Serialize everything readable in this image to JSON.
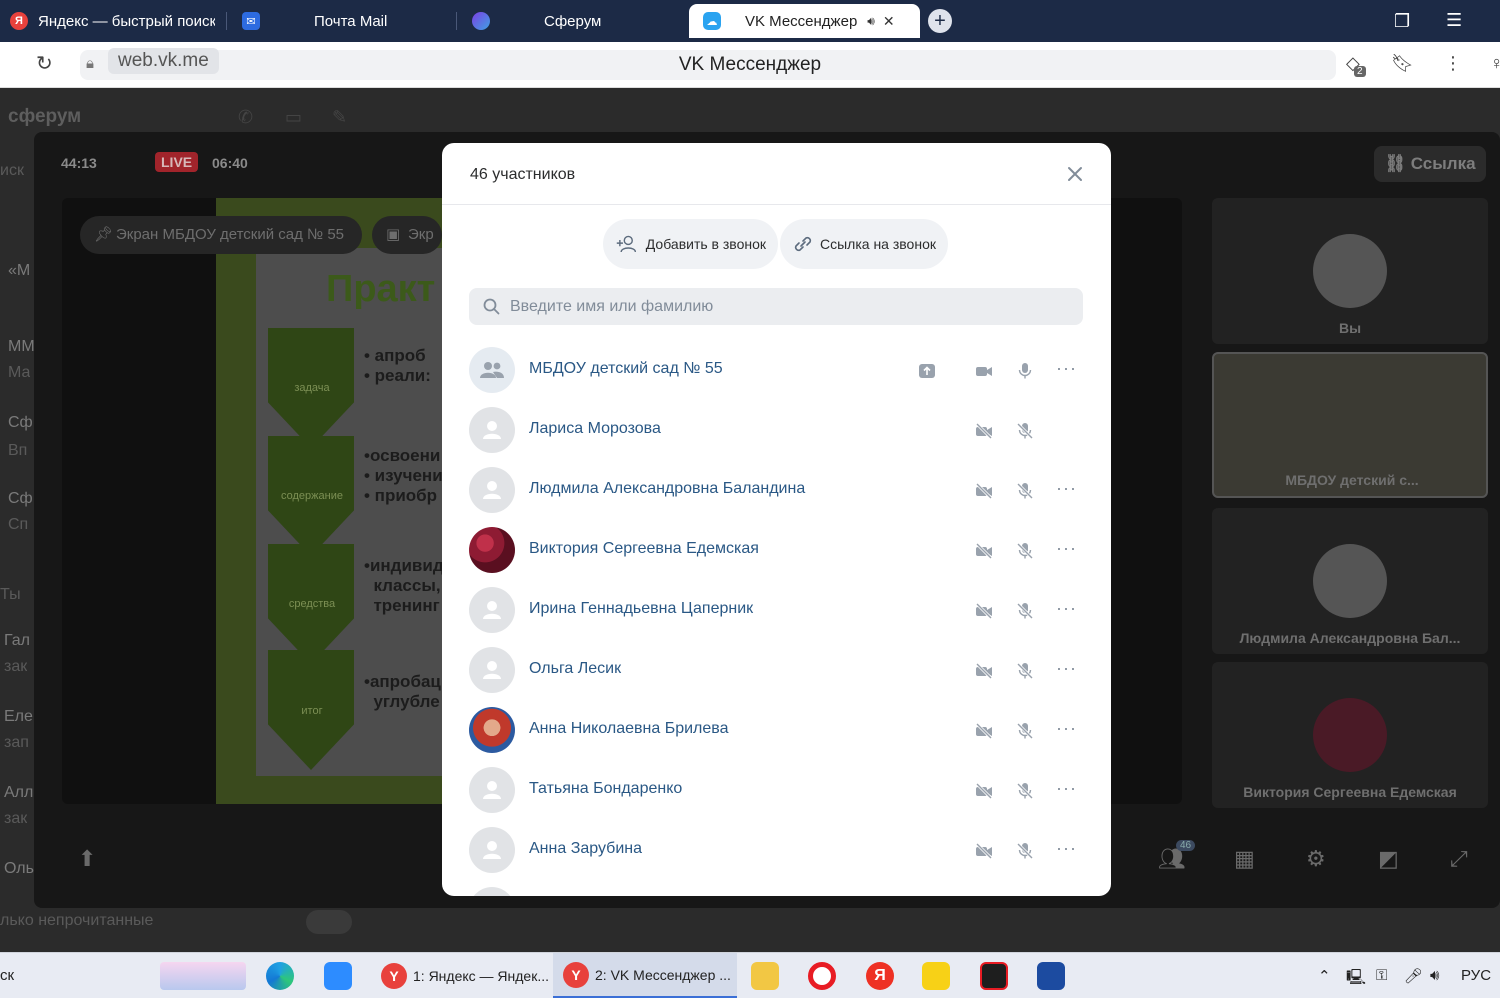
{
  "browser": {
    "tabs": [
      {
        "label": "Яндекс — быстрый поиск",
        "icon": "yandex-icon"
      },
      {
        "label": "Почта Mail",
        "icon": "mail-icon"
      },
      {
        "label": "Сферум",
        "icon": "sferum-icon"
      },
      {
        "label": "VK Мессенджер",
        "icon": "vk-messenger-icon",
        "active": true
      }
    ],
    "url_host": "web.vk.me",
    "page_title": "VK Мессенджер",
    "downloads_badge": "2"
  },
  "background": {
    "sidebar_title": "сферум",
    "sidebar_fragments": [
      "иск",
      "«М",
      "ММ",
      "Ма",
      "Сф",
      "Вп",
      "Сф",
      "Сп",
      "Ты",
      "Гал",
      "зак",
      "Еле",
      "зап",
      "Алл",
      "зак",
      "Оль"
    ],
    "unread_text": "лько непрочитанные",
    "call_timer": "44:13",
    "live_label": "LIVE",
    "live_time": "06:40",
    "link_button": "Ссылка",
    "screen_chip": "Экран МБДОУ детский сад № 55",
    "screen_chip_2": "Экр",
    "slide": {
      "title": "Практ",
      "labels": [
        "задача",
        "содержание",
        "средства",
        "итог"
      ],
      "texts": [
        "• апроб\n• реали:",
        "•освоени\n• изучени\n• приобр",
        "•индивид\n  классы,\n  тренинг",
        "•апробац\n  углубле"
      ]
    },
    "tiles": [
      {
        "name": "Вы"
      },
      {
        "name": "МБДОУ детский с..."
      },
      {
        "name": "Людмила Александровна Бал..."
      },
      {
        "name": "Виктория Сергеевна Едемская"
      }
    ],
    "participants_count_badge": "46"
  },
  "modal": {
    "title": "46 участников",
    "add_button": "Добавить в звонок",
    "link_button": "Ссылка на звонок",
    "search_placeholder": "Введите имя или фамилию",
    "search_value": "",
    "participants": [
      {
        "name": "МБДОУ детский сад № 55",
        "avatar": "group",
        "camera": "on",
        "mic": "on",
        "sharing": true
      },
      {
        "name": "Лариса Морозова",
        "avatar": "default",
        "camera": "off",
        "mic": "off",
        "menu": false
      },
      {
        "name": "Людмила Александровна Баландина",
        "avatar": "default",
        "camera": "off",
        "mic": "off"
      },
      {
        "name": "Виктория Сергеевна Едемская",
        "avatar": "berries",
        "camera": "off",
        "mic": "off"
      },
      {
        "name": "Ирина Геннадьевна Цаперник",
        "avatar": "default",
        "camera": "off",
        "mic": "off"
      },
      {
        "name": "Ольга Лесик",
        "avatar": "default",
        "camera": "off",
        "mic": "off"
      },
      {
        "name": "Анна Николаевна Брилева",
        "avatar": "photo",
        "camera": "off",
        "mic": "off"
      },
      {
        "name": "Татьяна Бондаренко",
        "avatar": "default",
        "camera": "off",
        "mic": "off"
      },
      {
        "name": "Анна Зарубина",
        "avatar": "default",
        "camera": "off",
        "mic": "off"
      }
    ],
    "more_icon_text": "···"
  },
  "taskbar": {
    "search_fragment": "ск",
    "items": [
      {
        "label": "1: Яндекс — Яндек..."
      },
      {
        "label": "2: VK Мессенджер ...",
        "active": true
      }
    ],
    "language": "РУС"
  },
  "colors": {
    "accent_link": "#2a5885",
    "tab_bar": "#1c2a46",
    "live_red": "#a1242b"
  }
}
